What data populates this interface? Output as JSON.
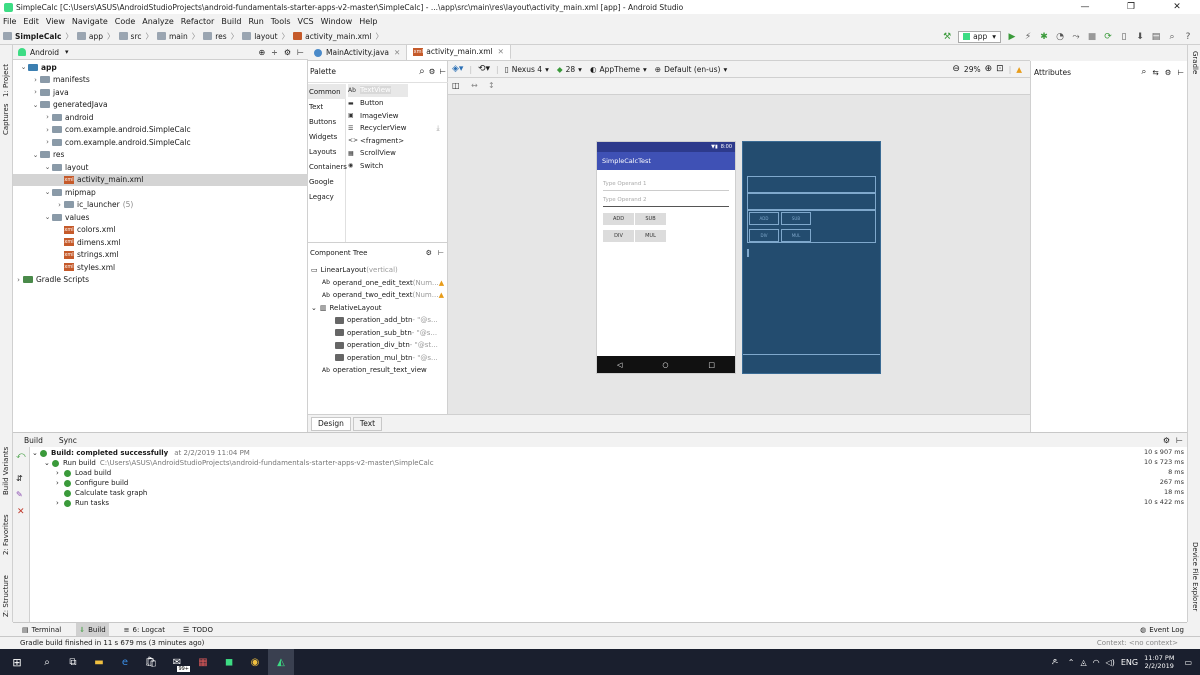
{
  "window": {
    "title": "SimpleCalc [C:\\Users\\ASUS\\AndroidStudioProjects\\android-fundamentals-starter-apps-v2-master\\SimpleCalc] - ...\\app\\src\\main\\res\\layout\\activity_main.xml [app] - Android Studio"
  },
  "menu": [
    "File",
    "Edit",
    "View",
    "Navigate",
    "Code",
    "Analyze",
    "Refactor",
    "Build",
    "Run",
    "Tools",
    "VCS",
    "Window",
    "Help"
  ],
  "breadcrumb": [
    "SimpleCalc",
    "app",
    "src",
    "main",
    "res",
    "layout",
    "activity_main.xml"
  ],
  "run_config": "app",
  "project": {
    "view_mode": "Android",
    "tree": [
      {
        "label": "app"
      },
      {
        "label": "manifests"
      },
      {
        "label": "java"
      },
      {
        "label": "generatedJava"
      },
      {
        "label": "android"
      },
      {
        "label": "com.example.android.SimpleCalc"
      },
      {
        "label": "com.example.android.SimpleCalc"
      },
      {
        "label": "res"
      },
      {
        "label": "layout"
      },
      {
        "label": "activity_main.xml"
      },
      {
        "label": "mipmap"
      },
      {
        "label": "ic_launcher",
        "extra": "(5)"
      },
      {
        "label": "values"
      },
      {
        "label": "colors.xml"
      },
      {
        "label": "dimens.xml"
      },
      {
        "label": "strings.xml"
      },
      {
        "label": "styles.xml"
      },
      {
        "label": "Gradle Scripts"
      }
    ]
  },
  "left_strip": {
    "project": "1: Project",
    "captures": "Captures",
    "build_variants": "Build Variants",
    "favorites": "2: Favorites",
    "structure": "Z: Structure"
  },
  "right_strip": {
    "gradle": "Gradle",
    "device_explorer": "Device File Explorer"
  },
  "editor_tabs": [
    "MainActivity.java",
    "activity_main.xml"
  ],
  "palette": {
    "title": "Palette",
    "categories": [
      "Common",
      "Text",
      "Buttons",
      "Widgets",
      "Layouts",
      "Containers",
      "Google",
      "Legacy"
    ],
    "items": [
      {
        "icon": "Ab",
        "label": "TextView"
      },
      {
        "icon": "",
        "label": "Button"
      },
      {
        "icon": "",
        "label": "ImageView"
      },
      {
        "icon": "",
        "label": "RecyclerView"
      },
      {
        "icon": "<>",
        "label": "<fragment>"
      },
      {
        "icon": "",
        "label": "ScrollView"
      },
      {
        "icon": "",
        "label": "Switch"
      }
    ]
  },
  "component_tree": {
    "title": "Component Tree",
    "rows": [
      {
        "label": "LinearLayout",
        "extra": "(vertical)"
      },
      {
        "icon": "Ab",
        "label": "operand_one_edit_text",
        "extra": "(Num..."
      },
      {
        "icon": "Ab",
        "label": "operand_two_edit_text",
        "extra": "(Num..."
      },
      {
        "label": "RelativeLayout"
      },
      {
        "label": "operation_add_btn",
        "extra": "- \"@s..."
      },
      {
        "label": "operation_sub_btn",
        "extra": "- \"@s..."
      },
      {
        "label": "operation_div_btn",
        "extra": "- \"@st..."
      },
      {
        "label": "operation_mul_btn",
        "extra": "- \"@s..."
      },
      {
        "icon": "Ab",
        "label": "operation_result_text_view"
      }
    ]
  },
  "design_toolbar": {
    "device": "Nexus 4",
    "api": "28",
    "theme": "AppTheme",
    "locale": "Default (en-us)",
    "zoom": "29%"
  },
  "attributes": {
    "title": "Attributes"
  },
  "design_tabs": [
    "Design",
    "Text"
  ],
  "phone_preview": {
    "time": "8:00",
    "app_title": "SimpleCalcTest",
    "hint1": "Type Operand 1",
    "hint2": "Type Operand 2",
    "buttons": [
      "ADD",
      "SUB",
      "DIV",
      "MUL"
    ]
  },
  "build": {
    "tabs": [
      "Build",
      "Sync"
    ],
    "rows": [
      {
        "label": "Build: completed successfully",
        "extra": "at 2/2/2019 11:04 PM",
        "time": "10 s 907 ms"
      },
      {
        "label": "Run build",
        "extra": "C:\\Users\\ASUS\\AndroidStudioProjects\\android-fundamentals-starter-apps-v2-master\\SimpleCalc",
        "time": "10 s 723 ms"
      },
      {
        "label": "Load build",
        "time": "8 ms"
      },
      {
        "label": "Configure build",
        "time": "267 ms"
      },
      {
        "label": "Calculate task graph",
        "time": "18 ms"
      },
      {
        "label": "Run tasks",
        "time": "10 s 422 ms"
      }
    ]
  },
  "bottom_tools": [
    "Terminal",
    "Build",
    "6: Logcat",
    "TODO"
  ],
  "event_log": "Event Log",
  "status": {
    "message": "Gradle build finished in 11 s 679 ms (3 minutes ago)",
    "context": "Context: <no context>"
  },
  "taskbar": {
    "time": "11:07 PM",
    "date": "2/2/2019",
    "badge": "99+"
  }
}
